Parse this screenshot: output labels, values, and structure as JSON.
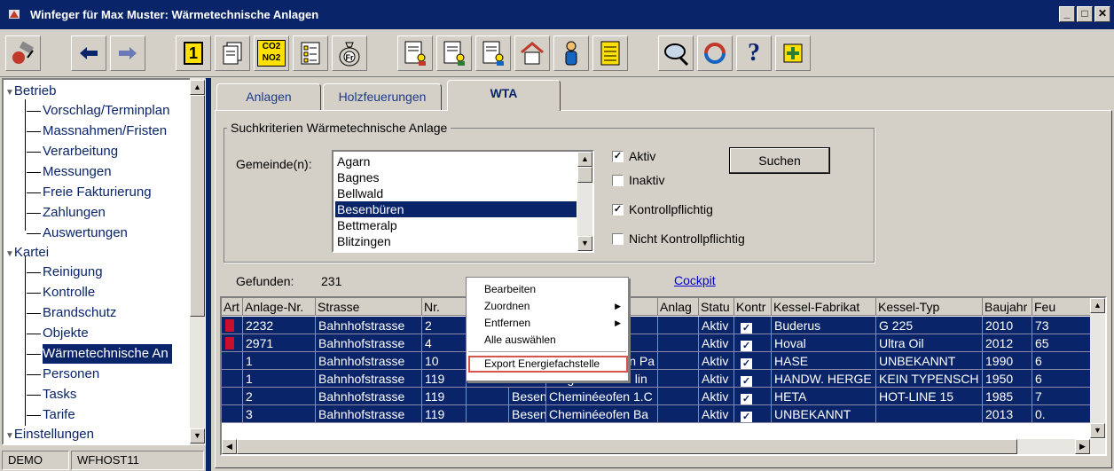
{
  "window": {
    "title": "Winfeger für Max Muster: Wärmetechnische Anlagen"
  },
  "sidebar": {
    "groups": [
      {
        "label": "Betrieb",
        "items": [
          "Vorschlag/Terminplan",
          "Massnahmen/Fristen",
          "Verarbeitung",
          "Messungen",
          "Freie Fakturierung",
          "Zahlungen",
          "Auswertungen"
        ]
      },
      {
        "label": "Kartei",
        "items": [
          "Reinigung",
          "Kontrolle",
          "Brandschutz",
          "Objekte",
          "Wärmetechnische An",
          "Personen",
          "Tasks",
          "Tarife"
        ]
      },
      {
        "label": "Einstellungen",
        "items": []
      }
    ],
    "selected": "Wärmetechnische An"
  },
  "statusbar": {
    "left": "DEMO",
    "right": "WFHOST11"
  },
  "tabs": [
    {
      "label": "Anlagen",
      "active": false
    },
    {
      "label": "Holzfeuerungen",
      "active": false
    },
    {
      "label": "WTA",
      "active": true
    }
  ],
  "search": {
    "group_label": "Suchkriterien Wärmetechnische Anlage",
    "gemeinde_label": "Gemeinde(n):",
    "gemeinden": [
      "Agarn",
      "Bagnes",
      "Bellwald",
      "Besenbüren",
      "Bettmeralp",
      "Blitzingen"
    ],
    "selected_gemeinde": "Besenbüren",
    "checkboxes": [
      {
        "label": "Aktiv",
        "checked": true
      },
      {
        "label": "Inaktiv",
        "checked": false
      },
      {
        "label": "Kontrollpflichtig",
        "checked": true
      },
      {
        "label": "Nicht Kontrollpflichtig",
        "checked": false
      }
    ],
    "search_button": "Suchen"
  },
  "results": {
    "found_label": "Gefunden:",
    "found_count": "231",
    "cockpit_link": "Cockpit"
  },
  "grid": {
    "columns": [
      "Art",
      "Anlage-Nr.",
      "Strasse",
      "Nr.",
      "",
      "",
      "Anlag",
      "Statu",
      "Kontr",
      "Kessel-Fabrikat",
      "Kessel-Typ",
      "Baujahr",
      "Feu"
    ],
    "partial_header": "ung",
    "rows": [
      {
        "art": "red",
        "nr": "2232",
        "strasse": "Bahnhofstrasse",
        "hnr": "2",
        "ort": "",
        "bez": "",
        "anlag": "",
        "status": "Aktiv",
        "kontr": true,
        "fabrikat": "Buderus",
        "typ": "G 225",
        "baujahr": "2010",
        "feu": "73"
      },
      {
        "art": "red",
        "nr": "2971",
        "strasse": "Bahnhofstrasse",
        "hnr": "4",
        "ort": "",
        "bez": "",
        "anlag": "",
        "status": "Aktiv",
        "kontr": true,
        "fabrikat": "Hoval",
        "typ": "Ultra Oil",
        "baujahr": "2012",
        "feu": "65"
      },
      {
        "art": "",
        "nr": "1",
        "strasse": "Bahnhofstrasse",
        "hnr": "10",
        "ort": "",
        "bez": "eofen Pa",
        "anlag": "",
        "status": "Aktiv",
        "kontr": true,
        "fabrikat": "HASE",
        "typ": "UNBEKANNT",
        "baujahr": "1990",
        "feu": "6"
      },
      {
        "art": "",
        "nr": "1",
        "strasse": "Bahnhofstrasse",
        "hnr": "119",
        "ort": "Besen",
        "bez": "Tragofen 2.OG lin",
        "anlag": "",
        "status": "Aktiv",
        "kontr": true,
        "fabrikat": "HANDW. HERGE",
        "typ": "KEIN TYPENSCH",
        "baujahr": "1950",
        "feu": "6"
      },
      {
        "art": "",
        "nr": "2",
        "strasse": "Bahnhofstrasse",
        "hnr": "119",
        "ort": "Besen",
        "bez": "Cheminéeofen 1.C",
        "anlag": "",
        "status": "Aktiv",
        "kontr": true,
        "fabrikat": "HETA",
        "typ": "HOT-LINE 15",
        "baujahr": "1985",
        "feu": "7"
      },
      {
        "art": "",
        "nr": "3",
        "strasse": "Bahnhofstrasse",
        "hnr": "119",
        "ort": "Besen",
        "bez": "Cheminéeofen Ba",
        "anlag": "",
        "status": "Aktiv",
        "kontr": true,
        "fabrikat": "UNBEKANNT",
        "typ": "",
        "baujahr": "2013",
        "feu": "0."
      }
    ]
  },
  "context_menu": {
    "items": [
      "Bearbeiten",
      "Zuordnen",
      "Entfernen",
      "Alle auswählen",
      "Export Energiefachstelle"
    ],
    "submenu_items": [
      "Zuordnen",
      "Entfernen"
    ],
    "highlighted": "Export Energiefachstelle"
  },
  "toolbar": {
    "icons": [
      "app-logo-icon",
      "back-arrow-icon",
      "forward-arrow-icon",
      "number-one-icon",
      "documents-icon",
      "co2-no2-icon",
      "checklist-icon",
      "money-bag-icon",
      "document-user-1-icon",
      "document-user-2-icon",
      "document-user-3-icon",
      "house-icon",
      "person-icon",
      "notes-icon",
      "magnifier-icon",
      "refresh-icon",
      "help-icon",
      "add-icon"
    ],
    "co2_label": "CO2",
    "no2_label": "NO2",
    "one_label": "1",
    "help_label": "?",
    "money_label": "Fr"
  },
  "colors": {
    "selection": "#0a246a",
    "chrome": "#d4d0c8",
    "link": "#0000cc",
    "highlight_border": "#d9534f"
  }
}
